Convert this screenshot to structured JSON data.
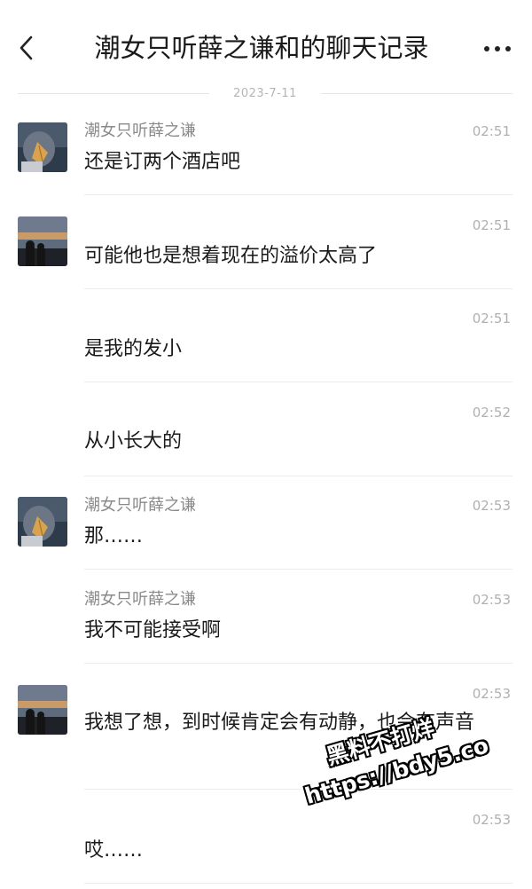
{
  "header": {
    "title": "潮女只听薛之谦和的聊天记录",
    "back_icon": "chevron-left-icon",
    "more_icon": "more-dots-icon"
  },
  "date_separator": "2023-7-11",
  "messages": [
    {
      "sender": "潮女只听薛之谦",
      "time": "02:51",
      "text": "还是订两个酒店吧",
      "avatar": "leaf-avatar"
    },
    {
      "sender": "",
      "time": "02:51",
      "text": "可能他也是想着现在的溢价太高了",
      "avatar": "sunset-avatar"
    },
    {
      "sender": "",
      "time": "02:51",
      "text": "是我的发小",
      "avatar": ""
    },
    {
      "sender": "",
      "time": "02:52",
      "text": "从小长大的",
      "avatar": ""
    },
    {
      "sender": "潮女只听薛之谦",
      "time": "02:53",
      "text": "那……",
      "avatar": "leaf-avatar"
    },
    {
      "sender": "潮女只听薛之谦",
      "time": "02:53",
      "text": "我不可能接受啊",
      "avatar": ""
    },
    {
      "sender": "",
      "time": "02:53",
      "text": "我想了想，到时候肯定会有动静，也会有声音",
      "avatar": "sunset-avatar"
    },
    {
      "sender": "",
      "time": "02:53",
      "text": "哎……",
      "avatar": ""
    }
  ],
  "watermark": {
    "line1": "黑料不打烊",
    "line2": "https://bdy5.co"
  }
}
